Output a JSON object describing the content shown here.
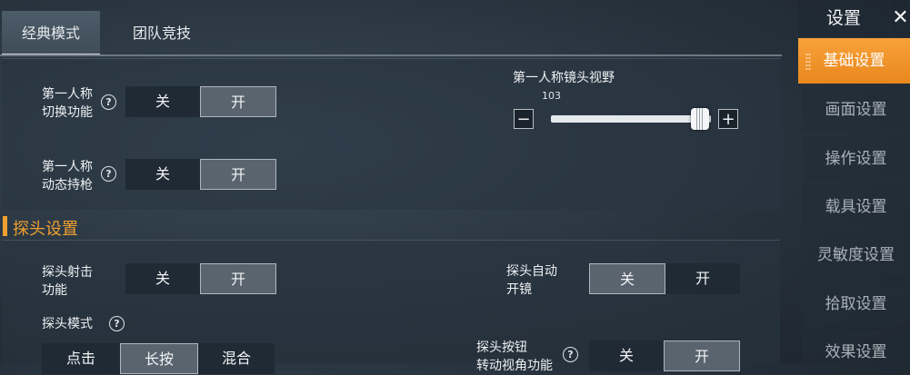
{
  "tabs": [
    {
      "label": "经典模式",
      "active": true
    },
    {
      "label": "团队竞技",
      "active": false
    }
  ],
  "first_person": {
    "switch_label_1": "第一人称",
    "switch_label_2": "切换功能",
    "dynamic_label_1": "第一人称",
    "dynamic_label_2": "动态持枪",
    "off": "关",
    "on": "开",
    "fov_title": "第一人称镜头视野",
    "fov_value": "103",
    "fov_fraction": 0.93,
    "minus": "−",
    "plus": "+"
  },
  "peek": {
    "section_title": "探头设置",
    "shoot_label_1": "探头射击",
    "shoot_label_2": "功能",
    "auto_scope_label_1": "探头自动",
    "auto_scope_label_2": "开镜",
    "mode_label": "探头模式",
    "mode_options": [
      "点击",
      "长按",
      "混合"
    ],
    "button_label_1": "探头按钮",
    "button_label_2": "转动视角功能",
    "off": "关",
    "on": "开"
  },
  "help_glyph": "?",
  "sidebar": {
    "title": "设置",
    "close": "✕",
    "items": [
      {
        "label": "基础设置",
        "active": true
      },
      {
        "label": "画面设置"
      },
      {
        "label": "操作设置"
      },
      {
        "label": "载具设置"
      },
      {
        "label": "灵敏度设置"
      },
      {
        "label": "拾取设置"
      },
      {
        "label": "效果设置"
      }
    ]
  },
  "colors": {
    "accent": "#f0a030",
    "panel": "#283440"
  }
}
